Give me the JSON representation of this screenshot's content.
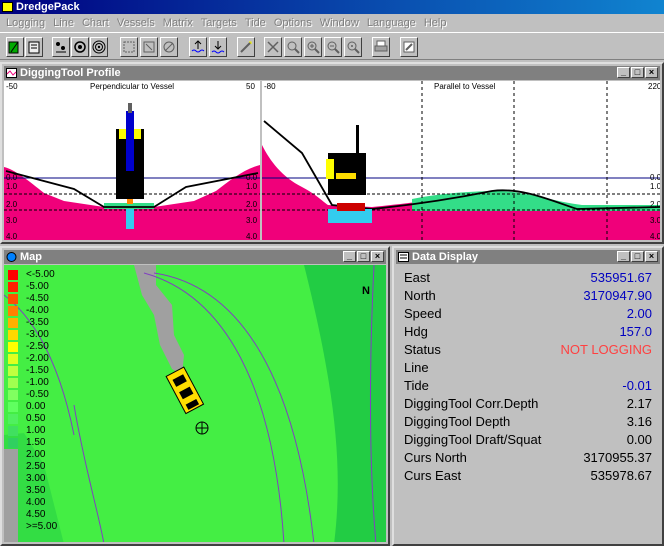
{
  "app": {
    "title": "DredgePack"
  },
  "menu": [
    "Logging",
    "Line",
    "Chart",
    "Vessels",
    "Matrix",
    "Targets",
    "Tide",
    "Options",
    "Window",
    "Language",
    "Help"
  ],
  "toolbar": {
    "buttons": [
      "open-chart-icon",
      "book-icon",
      "dots-tool-icon",
      "target-icon",
      "concentric-target-icon",
      "zoom-fit-icon",
      "zoom-window-icon",
      "rotate-icon",
      "tide-up-icon",
      "tide-down-icon",
      "line-tool-icon",
      "pan-icon",
      "zoom-icon",
      "zoom-in-icon",
      "zoom-out-icon",
      "zoom-reset-icon",
      "print-icon",
      "edit-icon"
    ]
  },
  "profile_window": {
    "title": "DiggingTool Profile",
    "left_panel": {
      "title": "Perpendicular to Vessel",
      "range_left": "-50",
      "range_right": "50",
      "depth_left": [
        "0.0",
        "1.0",
        "2.0",
        "3.0",
        "4.0"
      ],
      "depth_right": [
        "0.0",
        "1.0",
        "2.0",
        "3.0",
        "4.0"
      ]
    },
    "right_panel": {
      "title": "Parallel to Vessel",
      "range_left": "-80",
      "range_right": "220",
      "depth_right": [
        "0.0",
        "1.0",
        "2.0",
        "3.0",
        "4.0"
      ]
    }
  },
  "map_window": {
    "title": "Map",
    "north_label": "N",
    "legend": [
      {
        "label": "<-5.00",
        "color": "#ff0000"
      },
      {
        "label": "-5.00",
        "color": "#ff2000"
      },
      {
        "label": "-4.50",
        "color": "#ff5000"
      },
      {
        "label": "-4.00",
        "color": "#ff8000"
      },
      {
        "label": "-3.50",
        "color": "#ffb000"
      },
      {
        "label": "-3.00",
        "color": "#ffd800"
      },
      {
        "label": "-2.50",
        "color": "#ffff00"
      },
      {
        "label": "-2.00",
        "color": "#e0ff20"
      },
      {
        "label": "-1.50",
        "color": "#c0ff40"
      },
      {
        "label": "-1.00",
        "color": "#a0ff50"
      },
      {
        "label": "-0.50",
        "color": "#80ff60"
      },
      {
        "label": "0.00",
        "color": "#60ff60"
      },
      {
        "label": "0.50",
        "color": "#50f060"
      },
      {
        "label": "1.00",
        "color": "#40e060"
      },
      {
        "label": "1.50",
        "color": "#30d060"
      },
      {
        "label": "2.00",
        "color": "#a0a0a0"
      },
      {
        "label": "2.50",
        "color": "#a0a0a0"
      },
      {
        "label": "3.00",
        "color": "#a0a0a0"
      },
      {
        "label": "3.50",
        "color": "#a0a0a0"
      },
      {
        "label": "4.00",
        "color": "#a0a0a0"
      },
      {
        "label": "4.50",
        "color": "#a0a0a0"
      },
      {
        "label": ">=5.00",
        "color": "#a0a0a0"
      }
    ]
  },
  "data_window": {
    "title": "Data Display",
    "rows": [
      {
        "label": "East",
        "value": "535951.67",
        "color": "#0000c0"
      },
      {
        "label": "North",
        "value": "3170947.90",
        "color": "#0000c0"
      },
      {
        "label": "Speed",
        "value": "2.00",
        "color": "#0000c0"
      },
      {
        "label": "Hdg",
        "value": "157.0",
        "color": "#0000c0"
      },
      {
        "label": "Status",
        "value": "NOT LOGGING",
        "color": "#ff4040"
      },
      {
        "label": "Line",
        "value": "",
        "color": "#000000"
      },
      {
        "label": "Tide",
        "value": "-0.01",
        "color": "#0000c0"
      },
      {
        "label": "DiggingTool Corr.Depth",
        "value": "2.17",
        "color": "#000000"
      },
      {
        "label": "DiggingTool Depth",
        "value": "3.16",
        "color": "#000000"
      },
      {
        "label": "DiggingTool Draft/Squat",
        "value": "0.00",
        "color": "#000000"
      },
      {
        "label": "Curs North",
        "value": "3170955.37",
        "color": "#000000"
      },
      {
        "label": "Curs East",
        "value": "535978.67",
        "color": "#000000"
      }
    ]
  },
  "colors": {
    "seabed_fill": "#f0007a",
    "channel_fill": "#33dd88",
    "map_green": "#44ee44",
    "title_active": "#000080"
  }
}
